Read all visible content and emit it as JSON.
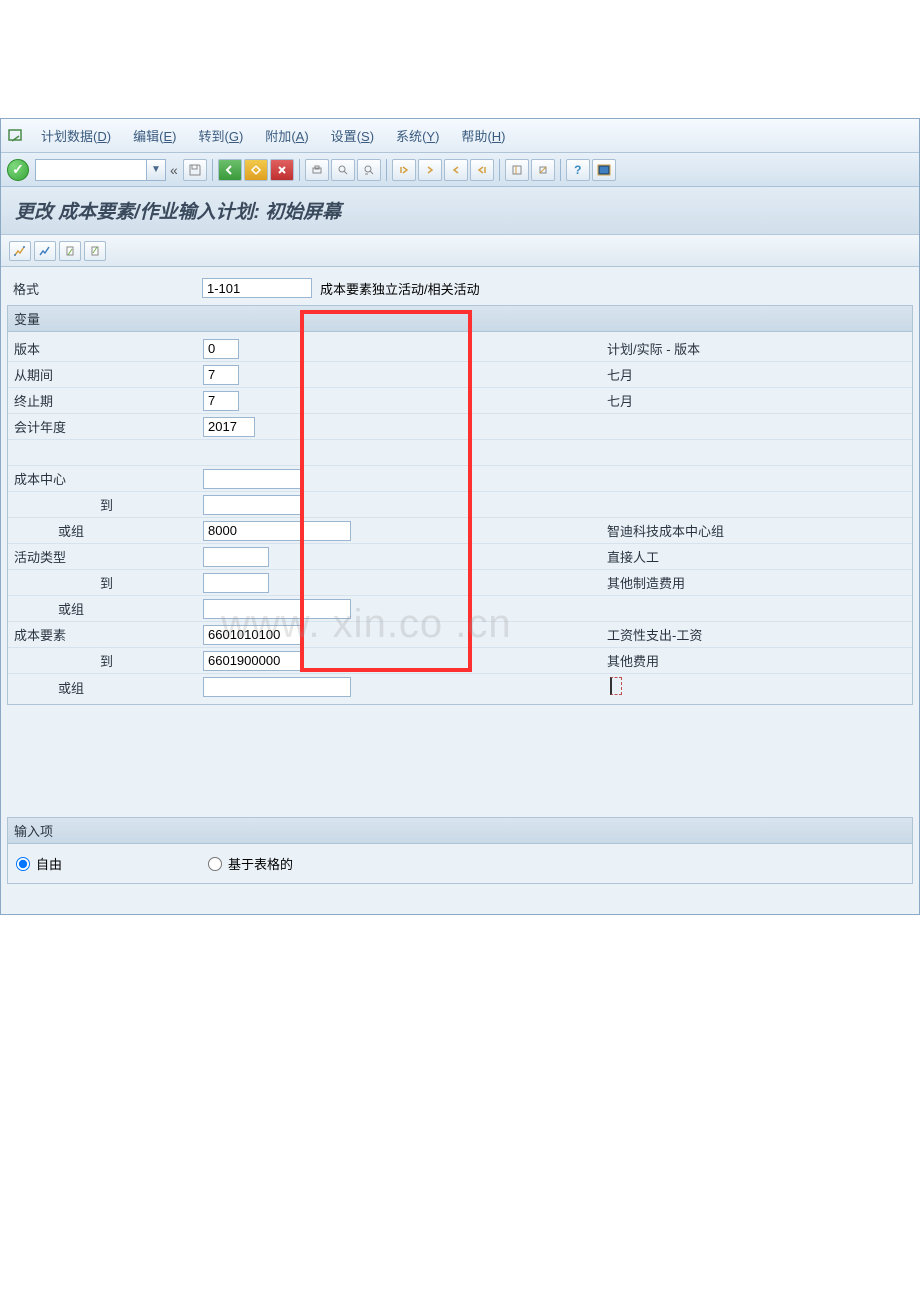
{
  "menu": {
    "items": [
      {
        "label": "计划数据",
        "key": "D"
      },
      {
        "label": "编辑",
        "key": "E"
      },
      {
        "label": "转到",
        "key": "G"
      },
      {
        "label": "附加",
        "key": "A"
      },
      {
        "label": "设置",
        "key": "S"
      },
      {
        "label": "系统",
        "key": "Y"
      },
      {
        "label": "帮助",
        "key": "H"
      }
    ]
  },
  "title": "更改 成本要素/作业输入计划: 初始屏幕",
  "format": {
    "label": "格式",
    "value": "1-101",
    "desc": "成本要素独立活动/相关活动"
  },
  "section_var": "变量",
  "fields": {
    "version": {
      "label": "版本",
      "value": "0",
      "desc": "计划/实际 - 版本"
    },
    "from_period": {
      "label": "从期间",
      "value": "7",
      "desc": "七月"
    },
    "to_period": {
      "label": "终止期",
      "value": "7",
      "desc": "七月"
    },
    "fiscal_year": {
      "label": "会计年度",
      "value": "2017",
      "desc": ""
    },
    "cost_center": {
      "label": "成本中心",
      "value": "",
      "desc": ""
    },
    "cost_center_to": {
      "label": "到",
      "value": "",
      "desc": ""
    },
    "cost_center_group": {
      "label": "或组",
      "value": "8000",
      "desc": "智迪科技成本中心组"
    },
    "activity_type": {
      "label": "活动类型",
      "value": "",
      "desc": "直接人工"
    },
    "activity_type_to": {
      "label": "到",
      "value": "",
      "desc": "其他制造费用"
    },
    "activity_type_group": {
      "label": "或组",
      "value": "",
      "desc": ""
    },
    "cost_element": {
      "label": "成本要素",
      "value": "6601010100",
      "desc": "工资性支出-工资"
    },
    "cost_element_to": {
      "label": "到",
      "value": "6601900000",
      "desc": "其他费用"
    },
    "cost_element_group": {
      "label": "或组",
      "value": "",
      "desc": ""
    }
  },
  "section_input": "输入项",
  "radios": {
    "free": "自由",
    "table": "基于表格的"
  },
  "watermark": "www.     xin.co   .cn"
}
